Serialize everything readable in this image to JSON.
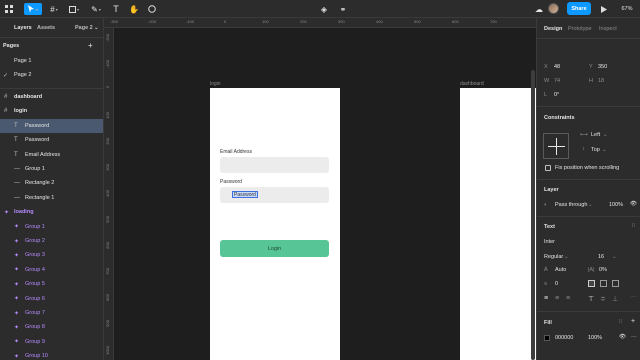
{
  "toolbar": {
    "zoom": "67%",
    "share_label": "Share",
    "icons": [
      "main-menu-icon",
      "move-tool-icon",
      "frame-tool-icon",
      "shape-tool-icon",
      "pen-tool-icon",
      "text-tool-icon",
      "hand-tool-icon",
      "comment-tool-icon",
      "component-icon",
      "link-icon",
      "mask-icon",
      "avatar",
      "play-icon"
    ]
  },
  "left_panel": {
    "tabs": {
      "layers": "Layers",
      "assets": "Assets",
      "page": "Page 2"
    },
    "pages_title": "Pages",
    "pages": [
      {
        "label": "Page 1",
        "current": false
      },
      {
        "label": "Page 2",
        "current": true
      }
    ],
    "layers": [
      {
        "label": "dashboard",
        "icon": "frame",
        "indent": 0
      },
      {
        "label": "login",
        "icon": "frame",
        "indent": 0
      },
      {
        "label": "Password",
        "icon": "T",
        "indent": 1,
        "selected": true
      },
      {
        "label": "Password",
        "icon": "T",
        "indent": 1
      },
      {
        "label": "Email Address",
        "icon": "T",
        "indent": 1
      },
      {
        "label": "Group 1",
        "icon": "—",
        "indent": 1
      },
      {
        "label": "Rectangle 2",
        "icon": "—",
        "indent": 1
      },
      {
        "label": "Rectangle 1",
        "icon": "—",
        "indent": 1
      },
      {
        "label": "loading",
        "icon": "component",
        "indent": 0,
        "component": true
      },
      {
        "label": "Group 1",
        "icon": "component",
        "indent": 1,
        "component": true
      },
      {
        "label": "Group 2",
        "icon": "component",
        "indent": 1,
        "component": true
      },
      {
        "label": "Group 3",
        "icon": "component",
        "indent": 1,
        "component": true
      },
      {
        "label": "Group 4",
        "icon": "component",
        "indent": 1,
        "component": true
      },
      {
        "label": "Group 5",
        "icon": "component",
        "indent": 1,
        "component": true
      },
      {
        "label": "Group 6",
        "icon": "component",
        "indent": 1,
        "component": true
      },
      {
        "label": "Group 7",
        "icon": "component",
        "indent": 1,
        "component": true
      },
      {
        "label": "Group 8",
        "icon": "component",
        "indent": 1,
        "component": true
      },
      {
        "label": "Group 9",
        "icon": "component",
        "indent": 1,
        "component": true
      },
      {
        "label": "Group 10",
        "icon": "component",
        "indent": 1,
        "component": true
      }
    ]
  },
  "rulers": {
    "horizontal": [
      "-300",
      "-200",
      "-100",
      "0",
      "100",
      "200",
      "300",
      "400",
      "500",
      "600",
      "700"
    ],
    "vertical": [
      "-200",
      "-100",
      "0",
      "100",
      "200",
      "300",
      "400",
      "500",
      "600",
      "700",
      "800",
      "900",
      "1000"
    ]
  },
  "canvas": {
    "frames": {
      "login": "login",
      "dashboard": "dashboard"
    },
    "login": {
      "email_label": "Email Address",
      "password_label": "Password",
      "password_value": "Password",
      "button_label": "Login"
    }
  },
  "right_panel": {
    "tabs": {
      "design": "Design",
      "prototype": "Prototype",
      "inspect": "Inspect"
    },
    "x_label": "X",
    "x_value": "48",
    "y_label": "Y",
    "y_value": "350",
    "w_label": "W",
    "w_value": "74",
    "h_label": "H",
    "h_value": "18",
    "rotation_label": "L",
    "rotation_value": "0°",
    "constraints_title": "Constraints",
    "constraint_h": "Left",
    "constraint_v": "Top",
    "fix_scroll": "Fix position when scrolling",
    "layer_title": "Layer",
    "blend": "Pass through",
    "opacity": "100%",
    "text_title": "Text",
    "font_family": "Inter",
    "font_weight": "Regular",
    "font_size": "16",
    "line_height": "Auto",
    "letter_spacing": "0%",
    "paragraph": "0",
    "fill_title": "Fill",
    "fill_hex": "000000",
    "fill_opacity": "100%",
    "colors": {
      "accent": "#0d99ff",
      "login_button": "#57c596",
      "selection": "#4a5870"
    }
  }
}
